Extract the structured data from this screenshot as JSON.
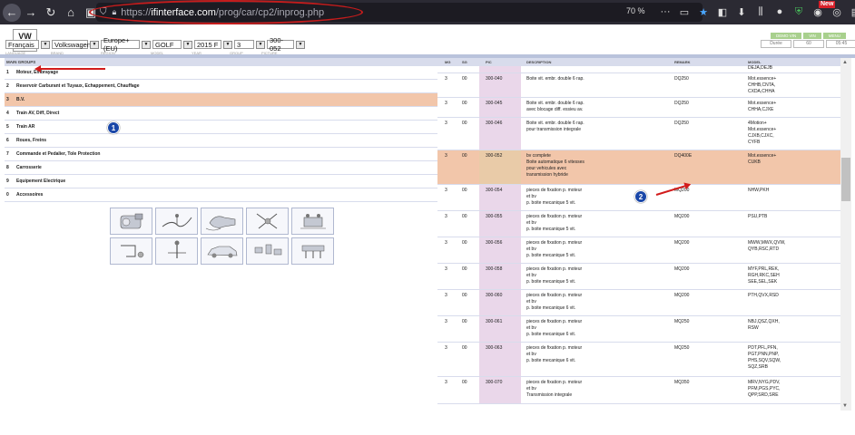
{
  "browser": {
    "url_prefix": "https://",
    "url_domain": "ifinterface.com",
    "url_path": "/prog/car/cp2/inprog.php",
    "zoom": "70 %",
    "new_badge": "New"
  },
  "app": {
    "logo_text": "VW",
    "logo_sub": "CarProg",
    "top_buttons": [
      "DEMO VIN",
      "VIN",
      "MENU"
    ],
    "info_boxes": [
      "Durée",
      "60",
      "05:45"
    ]
  },
  "selectors": {
    "values": [
      "Français",
      "Volkswagen",
      "Europe+ (EU)",
      "GOLF",
      "2015  F",
      "3",
      "300-052"
    ],
    "labels": [
      "LANGUAGE",
      "BRAND",
      "REGION",
      "MODEL",
      "YEAR",
      "GROUP",
      "PICTURE"
    ]
  },
  "main_groups": {
    "header": "MAIN GROUPS",
    "items": [
      {
        "num": "1",
        "label": "Moteur, Embrayage"
      },
      {
        "num": "2",
        "label": "Reservoir Carburant et Tuyaux, Echappement, Chauffage"
      },
      {
        "num": "3",
        "label": "B.V."
      },
      {
        "num": "4",
        "label": "Train AV, Diff, Direct"
      },
      {
        "num": "5",
        "label": "Train AR"
      },
      {
        "num": "6",
        "label": "Roues, Freins"
      },
      {
        "num": "7",
        "label": "Commande et Pedalier, Tole Protection"
      },
      {
        "num": "8",
        "label": "Carrosserie"
      },
      {
        "num": "9",
        "label": "Equipement Electrique"
      },
      {
        "num": "0",
        "label": "Accessoires"
      }
    ],
    "active_index": 2
  },
  "annotations": {
    "badge1": "1",
    "badge2": "2"
  },
  "parts_table": {
    "headers": {
      "mg": "MG",
      "sg": "SG",
      "pic": "PIC",
      "description": "DESCRIPTION",
      "remark": "REMARK",
      "model": "MODEL"
    },
    "top_model_remnant": "DEJA,DEJB",
    "rows": [
      {
        "mg": "3",
        "sg": "00",
        "pic": "300-040",
        "desc": [
          "Boite vit. embr. double 6 rap."
        ],
        "remark": "DQ250",
        "model": [
          "Mot.essence+",
          "CHHB,CNTA,",
          "CXDA,CHHA"
        ]
      },
      {
        "mg": "3",
        "sg": "00",
        "pic": "300-045",
        "desc": [
          "Boite vit. embr. double 6 rap.",
          "avec blocage diff. essieu av."
        ],
        "remark": "DQ250",
        "model": [
          "Mot.essence+",
          "CHHA,CJXE"
        ]
      },
      {
        "mg": "3",
        "sg": "00",
        "pic": "300-046",
        "desc": [
          "Boite vit. embr. double 6 rap.",
          "pour transmission integrale"
        ],
        "remark": "DQ250",
        "model": [
          "4Motion+",
          "Mot.essence+",
          "CJXB,CJXC,",
          "CYFB"
        ]
      },
      {
        "mg": "3",
        "sg": "00",
        "pic": "300-052",
        "desc": [
          "bv complete",
          "Boite automatique 6 vitesses",
          "pour vehicules avec",
          "transmission hybride"
        ],
        "remark": "DQ400E",
        "model": [
          "Mot.essence+",
          "CUKB"
        ]
      },
      {
        "mg": "3",
        "sg": "00",
        "pic": "300-054",
        "desc": [
          "pieces de fixation p. moteur",
          "et bv",
          "p. boite mecanique 5 vit."
        ],
        "remark": "MQ200",
        "model": [
          "NHW,PKH"
        ]
      },
      {
        "mg": "3",
        "sg": "00",
        "pic": "300-055",
        "desc": [
          "pieces de fixation p. moteur",
          "et bv",
          "p. boite mecanique 5 vit."
        ],
        "remark": "MQ200",
        "model": [
          "PSU,PTB"
        ]
      },
      {
        "mg": "3",
        "sg": "00",
        "pic": "300-056",
        "desc": [
          "pieces de fixation p. moteur",
          "et bv",
          "p. boite mecanique 5 vit."
        ],
        "remark": "MQ200",
        "model": [
          "MWW,MWX,QVW,",
          "QYB,RSC,RTD"
        ]
      },
      {
        "mg": "3",
        "sg": "00",
        "pic": "300-058",
        "desc": [
          "pieces de fixation p. moteur",
          "et bv",
          "p. boite mecanique 5 vit."
        ],
        "remark": "MQ200",
        "model": [
          "MYF,PRL,REK,",
          "RGH,RKC,SEH",
          "SEE,SEL,SEK"
        ]
      },
      {
        "mg": "3",
        "sg": "00",
        "pic": "300-060",
        "desc": [
          "pieces de fixation p. moteur",
          "et bv",
          "p. boite mecanique 6 vit."
        ],
        "remark": "MQ200",
        "model": [
          "PTH,QVX,RSD"
        ]
      },
      {
        "mg": "3",
        "sg": "00",
        "pic": "300-061",
        "desc": [
          "pieces de fixation p. moteur",
          "et bv",
          "p. boite mecanique 6 vit."
        ],
        "remark": "MQ250",
        "model": [
          "NBJ,QSZ,QXH,",
          "RSW"
        ]
      },
      {
        "mg": "3",
        "sg": "00",
        "pic": "300-063",
        "desc": [
          "pieces de fixation p. moteur",
          "et bv",
          "p. boite mecanique 6 vit."
        ],
        "remark": "MQ250",
        "model": [
          "PDT,PFL,PFN,",
          "PGT,PNN,PNP,",
          "PHS,SQV,SQW,",
          "SQZ,SRB"
        ]
      },
      {
        "mg": "3",
        "sg": "00",
        "pic": "300-070",
        "desc": [
          "pieces de fixation p. moteur",
          "et bv",
          "Transmission integrale"
        ],
        "remark": "MQ350",
        "model": [
          "MRV,NYG,PDV,",
          "PFM,PGS,PYC,",
          "QPP,SRD,SRE"
        ]
      }
    ],
    "active_index": 3
  },
  "thumbnails": [
    "gearbox-thumb",
    "shift-cable-thumb",
    "transmission-thumb",
    "linkage-thumb",
    "mount-thumb",
    "bracket-thumb",
    "lever-thumb",
    "car-body-thumb",
    "fixing-parts-thumb",
    "bolts-thumb"
  ]
}
